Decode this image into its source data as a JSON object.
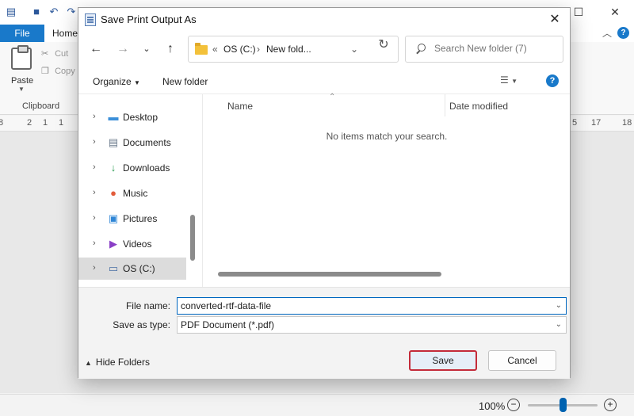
{
  "app": {
    "tabs": {
      "file": "File",
      "home": "Home"
    },
    "clipboard": {
      "paste": "Paste",
      "cut": "Cut",
      "copy": "Copy",
      "group": "Clipboard"
    },
    "ruler_left": [
      "8",
      "2",
      "1",
      "1"
    ],
    "ruler_right": [
      "5",
      "17",
      "18"
    ],
    "zoom": "100%",
    "zoom_level": 0.5
  },
  "dialog": {
    "title": "Save Print Output As",
    "address": {
      "root": "OS (C:)",
      "current": "New fold..."
    },
    "search": {
      "placeholder": "Search New folder (7)"
    },
    "toolbar": {
      "organize": "Organize",
      "new_folder": "New folder"
    },
    "nav_items": [
      {
        "label": "Desktop",
        "icon": "desktop-icon"
      },
      {
        "label": "Documents",
        "icon": "documents-icon"
      },
      {
        "label": "Downloads",
        "icon": "downloads-icon"
      },
      {
        "label": "Music",
        "icon": "music-icon"
      },
      {
        "label": "Pictures",
        "icon": "pictures-icon"
      },
      {
        "label": "Videos",
        "icon": "videos-icon"
      },
      {
        "label": "OS (C:)",
        "icon": "drive-icon"
      }
    ],
    "columns": {
      "name": "Name",
      "date": "Date modified"
    },
    "empty_message": "No items match your search.",
    "form": {
      "file_name_label": "File name:",
      "file_name_value": "converted-rtf-data-file",
      "type_label": "Save as type:",
      "type_value": "PDF Document (*.pdf)"
    },
    "hide_folders": "Hide Folders",
    "save": "Save",
    "cancel": "Cancel"
  },
  "colors": {
    "accent": "#1979ca",
    "save_outline": "#c42b3a",
    "folder": "#f3c13a"
  }
}
